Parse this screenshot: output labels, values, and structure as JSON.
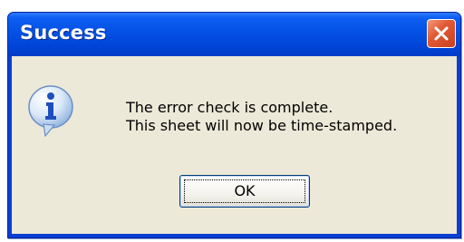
{
  "dialog": {
    "title": "Success",
    "message_lines": [
      "The error check is complete.",
      "This sheet will now be time-stamped."
    ],
    "ok_label": "OK",
    "icon": "info-icon",
    "close_icon": "close-icon"
  },
  "colors": {
    "titlebar": "#0551e5",
    "client": "#ece9d8",
    "close_button": "#e25a35"
  }
}
